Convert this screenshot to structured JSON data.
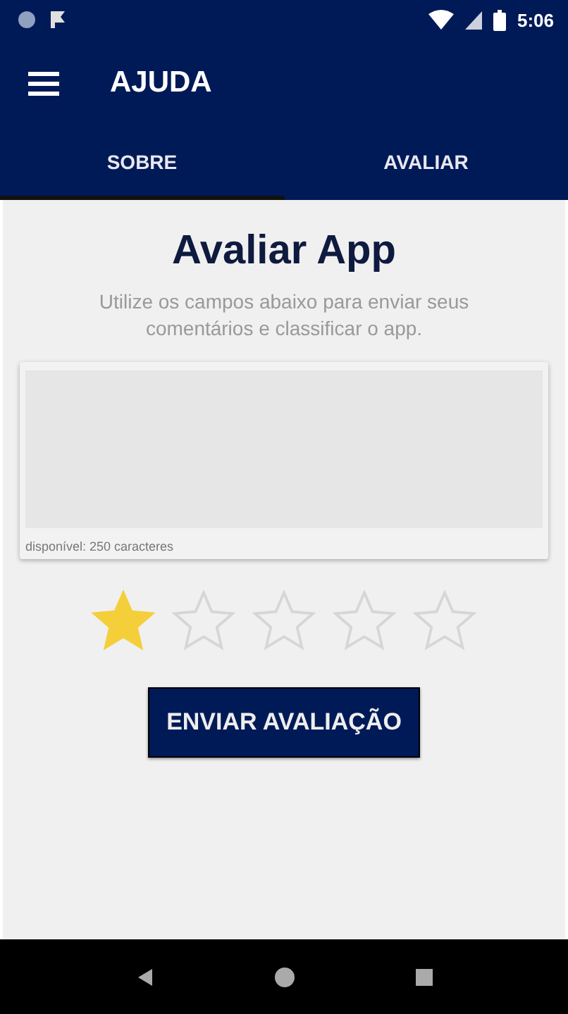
{
  "status_bar": {
    "time": "5:06"
  },
  "toolbar": {
    "title": "AJUDA"
  },
  "tabs": [
    {
      "label": "SOBRE",
      "selected": true
    },
    {
      "label": "AVALIAR",
      "selected": false
    }
  ],
  "content": {
    "title": "Avaliar App",
    "subtitle": "Utilize os campos abaixo para enviar seus comentários e classificar o app.",
    "comment_field": {
      "counter": "disponível: 250 caracteres"
    },
    "rating": {
      "stars": 1
    },
    "submit_button": "ENVIAR AVALIAÇÃO"
  }
}
